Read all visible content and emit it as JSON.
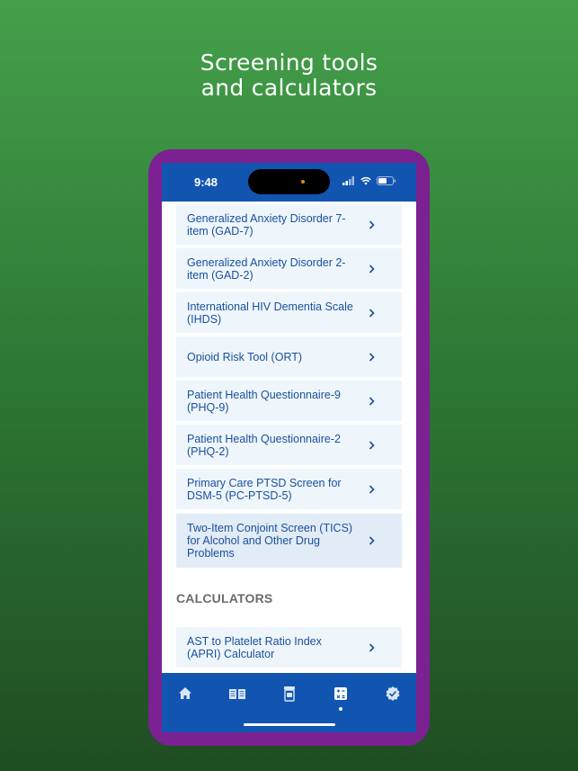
{
  "headline": {
    "line1": "Screening tools",
    "line2": "and calculators"
  },
  "status_bar": {
    "time": "9:48",
    "icons": [
      "signal-icon",
      "wifi-icon",
      "battery-icon"
    ]
  },
  "screening_items": [
    {
      "label": "Generalized Anxiety Disorder 7-item (GAD-7)"
    },
    {
      "label": "Generalized Anxiety Disorder 2-item (GAD-2)"
    },
    {
      "label": "International HIV Dementia Scale (IHDS)"
    },
    {
      "label": "Opioid Risk Tool (ORT)"
    },
    {
      "label": "Patient Health Questionnaire-9 (PHQ-9)"
    },
    {
      "label": "Patient Health Questionnaire-2 (PHQ-2)"
    },
    {
      "label": "Primary Care PTSD Screen for DSM-5 (PC-PTSD-5)"
    },
    {
      "label": "Two-Item Conjoint Screen (TICS) for Alcohol and Other Drug Problems"
    }
  ],
  "calculators": {
    "heading": "CALCULATORS",
    "items": [
      {
        "label": "AST to Platelet Ratio Index (APRI) Calculator"
      }
    ]
  },
  "tab_bar": {
    "tabs": [
      "home-icon",
      "book-icon",
      "pill-bottle-icon",
      "calculator-icon",
      "verified-badge-icon"
    ],
    "active_index": 3
  },
  "colors": {
    "frame": "#7b2192",
    "brand_blue": "#1155b0",
    "item_bg": "#eef6fc",
    "item_text": "#1a4f9c",
    "background_green": "#2f7a36"
  }
}
